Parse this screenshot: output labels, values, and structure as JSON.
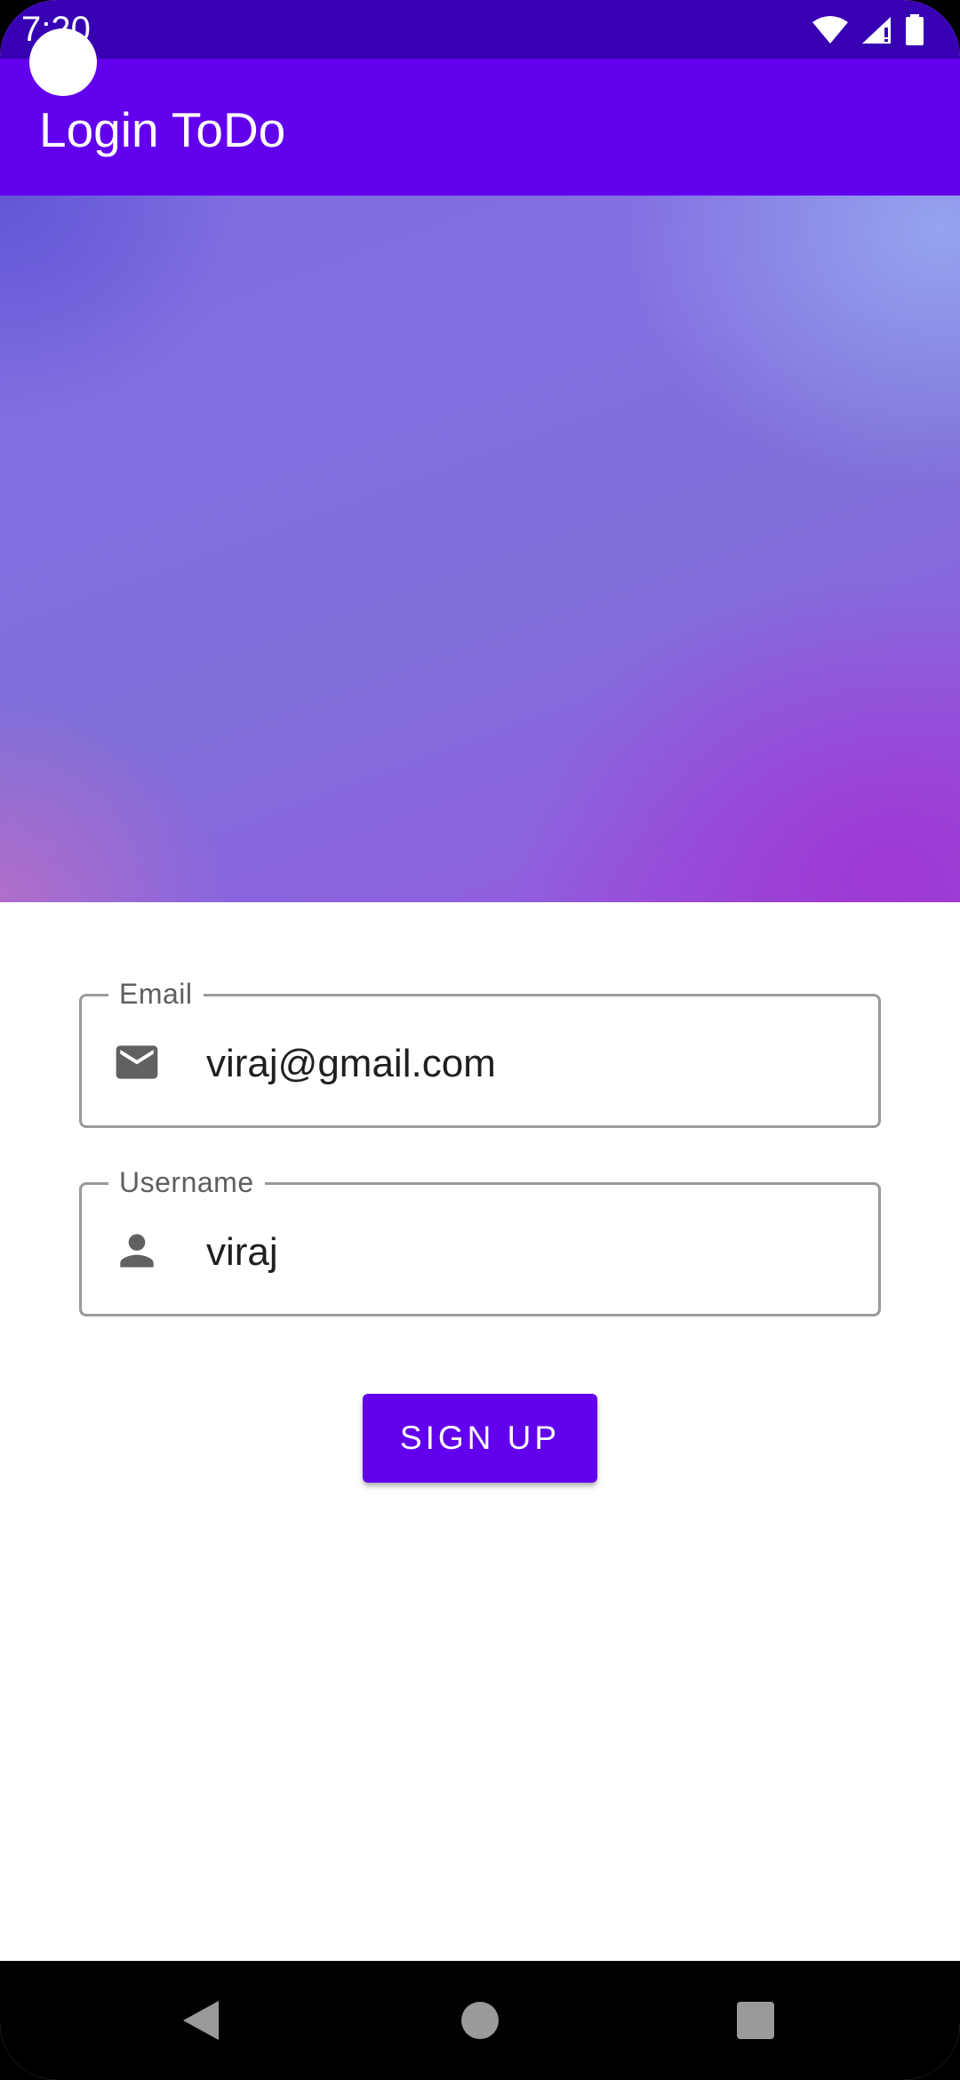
{
  "status_bar": {
    "time": "7:20",
    "icons": [
      "wifi-icon",
      "cell-signal-icon",
      "battery-icon"
    ]
  },
  "app_bar": {
    "title": "Login ToDo"
  },
  "form": {
    "email": {
      "label": "Email",
      "value": "viraj@gmail.com",
      "icon": "email-icon"
    },
    "username": {
      "label": "Username",
      "value": "viraj",
      "icon": "person-icon"
    },
    "signup_label": "SIGN UP"
  },
  "nav_bar": {
    "buttons": [
      "back-icon",
      "home-icon",
      "recents-icon"
    ]
  },
  "colors": {
    "primary": "#6200EE",
    "primary_dark": "#3700B3",
    "field_border": "#9a9a9a",
    "label_text": "#5f5f5f"
  }
}
